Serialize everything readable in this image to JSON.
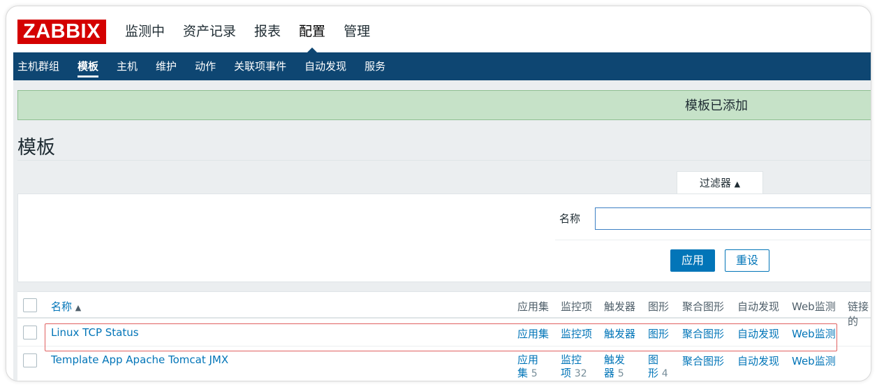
{
  "logo": "ZABBIX",
  "main_menu": [
    "监测中",
    "资产记录",
    "报表",
    "配置",
    "管理"
  ],
  "main_menu_active": "配置",
  "sub_menu": [
    "主机群组",
    "模板",
    "主机",
    "维护",
    "动作",
    "关联项事件",
    "自动发现",
    "服务"
  ],
  "sub_menu_active": "模板",
  "message": "模板已添加",
  "page_title": "模板",
  "filter": {
    "tab_label": "过滤器",
    "tab_arrow": "▲",
    "name_label": "名称",
    "name_value": "",
    "apply_label": "应用",
    "reset_label": "重设"
  },
  "table": {
    "header": {
      "name": "名称",
      "sort_arrow": "▲",
      "applications": "应用集",
      "items": "监控项",
      "triggers": "触发器",
      "graphs": "图形",
      "screens": "聚合图形",
      "discovery": "自动发现",
      "web": "Web监测",
      "linked": "链接的"
    },
    "rows": [
      {
        "name": "Linux TCP Status",
        "applications": "应用集",
        "items": "监控项",
        "triggers": "触发器",
        "graphs": "图形",
        "screens": "聚合图形",
        "discovery": "自动发现",
        "web": "Web监测"
      },
      {
        "name": "Template App Apache Tomcat JMX",
        "applications_1": "应用",
        "applications_2": "集",
        "applications_count": "5",
        "items_1": "监控",
        "items_2": "项",
        "items_count": "32",
        "triggers_1": "触发",
        "triggers_2": "器",
        "triggers_count": "5",
        "graphs_1": "图",
        "graphs_2": "形",
        "graphs_count": "4",
        "screens": "聚合图形",
        "discovery": "自动发现",
        "web": "Web监测"
      }
    ]
  },
  "colors": {
    "brand": "#d40000",
    "nav": "#0e4672",
    "link": "#0275b8",
    "success_bg": "#c6e2c8",
    "highlight_border": "#e06060"
  }
}
